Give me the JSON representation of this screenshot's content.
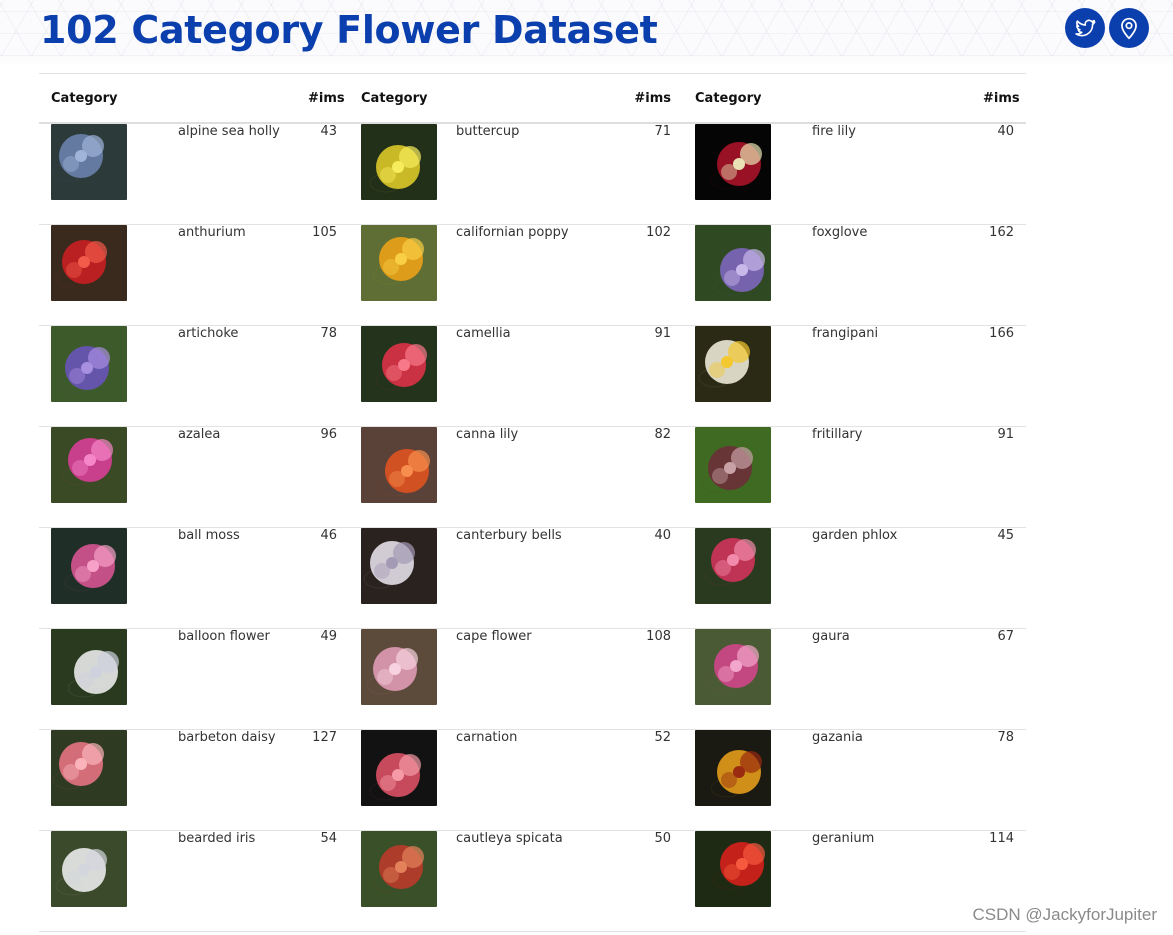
{
  "page": {
    "title": "102 Category Flower Dataset"
  },
  "social": {
    "twitter_icon": "twitter-bird-icon",
    "location_icon": "map-pin-icon",
    "accent": "#0b3fae"
  },
  "table": {
    "header_category": "Category",
    "header_count": "#ims",
    "rows": [
      [
        {
          "name": "alpine sea holly",
          "count": "43",
          "palette": [
            "#2c3a3a",
            "#6f86b4",
            "#9fb4d8"
          ]
        },
        {
          "name": "buttercup",
          "count": "71",
          "palette": [
            "#22301a",
            "#e8d12a",
            "#f6ec5c"
          ]
        },
        {
          "name": "fire lily",
          "count": "40",
          "palette": [
            "#050505",
            "#b3142a",
            "#e9e2b4"
          ]
        }
      ],
      [
        {
          "name": "anthurium",
          "count": "105",
          "palette": [
            "#3a2a1e",
            "#d11f22",
            "#f25a4a"
          ]
        },
        {
          "name": "californian poppy",
          "count": "102",
          "palette": [
            "#5e6e35",
            "#f3a514",
            "#f9cf46"
          ]
        },
        {
          "name": "foxglove",
          "count": "162",
          "palette": [
            "#2f4a22",
            "#8267c6",
            "#c9b8ea"
          ]
        }
      ],
      [
        {
          "name": "artichoke",
          "count": "78",
          "palette": [
            "#3d5a2a",
            "#6b55c2",
            "#a88fe0"
          ]
        },
        {
          "name": "camellia",
          "count": "91",
          "palette": [
            "#23331c",
            "#e8334a",
            "#f8798a"
          ]
        },
        {
          "name": "frangipani",
          "count": "166",
          "palette": [
            "#2b2a14",
            "#f7f3e2",
            "#f4c82f"
          ]
        }
      ],
      [
        {
          "name": "azalea",
          "count": "96",
          "palette": [
            "#3a4a24",
            "#e23d9d",
            "#f586c7"
          ]
        },
        {
          "name": "canna lily",
          "count": "82",
          "palette": [
            "#5a4238",
            "#e8531e",
            "#f78e4d"
          ]
        },
        {
          "name": "fritillary",
          "count": "91",
          "palette": [
            "#3f6a22",
            "#6e2b3a",
            "#c8a1a6"
          ]
        }
      ],
      [
        {
          "name": "ball moss",
          "count": "46",
          "palette": [
            "#1f2f27",
            "#e0579a",
            "#f7a0c8"
          ]
        },
        {
          "name": "canterbury bells",
          "count": "40",
          "palette": [
            "#2a221e",
            "#eeeaf5",
            "#a39ab5"
          ]
        },
        {
          "name": "garden phlox",
          "count": "45",
          "palette": [
            "#2a3a1e",
            "#d9335f",
            "#f28bab"
          ]
        }
      ],
      [
        {
          "name": "balloon flower",
          "count": "49",
          "palette": [
            "#2a3a1e",
            "#f4f4f6",
            "#cfd1de"
          ]
        },
        {
          "name": "cape flower",
          "count": "108",
          "palette": [
            "#5c4a3a",
            "#e6a0bc",
            "#f7d2e0"
          ]
        },
        {
          "name": "gaura",
          "count": "67",
          "palette": [
            "#4a5a34",
            "#d8458f",
            "#f3a6cb"
          ]
        }
      ],
      [
        {
          "name": "barbeton daisy",
          "count": "127",
          "palette": [
            "#2e3a22",
            "#f07888",
            "#fbb3bb"
          ]
        },
        {
          "name": "carnation",
          "count": "52",
          "palette": [
            "#121212",
            "#e8556a",
            "#f59aa6"
          ]
        },
        {
          "name": "gazania",
          "count": "78",
          "palette": [
            "#1a1a12",
            "#f0a51a",
            "#9a2a10"
          ]
        }
      ],
      [
        {
          "name": "bearded iris",
          "count": "54",
          "palette": [
            "#3a4a2a",
            "#f4f4f6",
            "#d4d6de"
          ]
        },
        {
          "name": "cautleya spicata",
          "count": "50",
          "palette": [
            "#3a5028",
            "#c23a2a",
            "#e3825a"
          ]
        },
        {
          "name": "geranium",
          "count": "114",
          "palette": [
            "#1e2a14",
            "#e0201a",
            "#f55a3e"
          ]
        }
      ]
    ]
  },
  "watermark": "CSDN @JackyforJupiter"
}
